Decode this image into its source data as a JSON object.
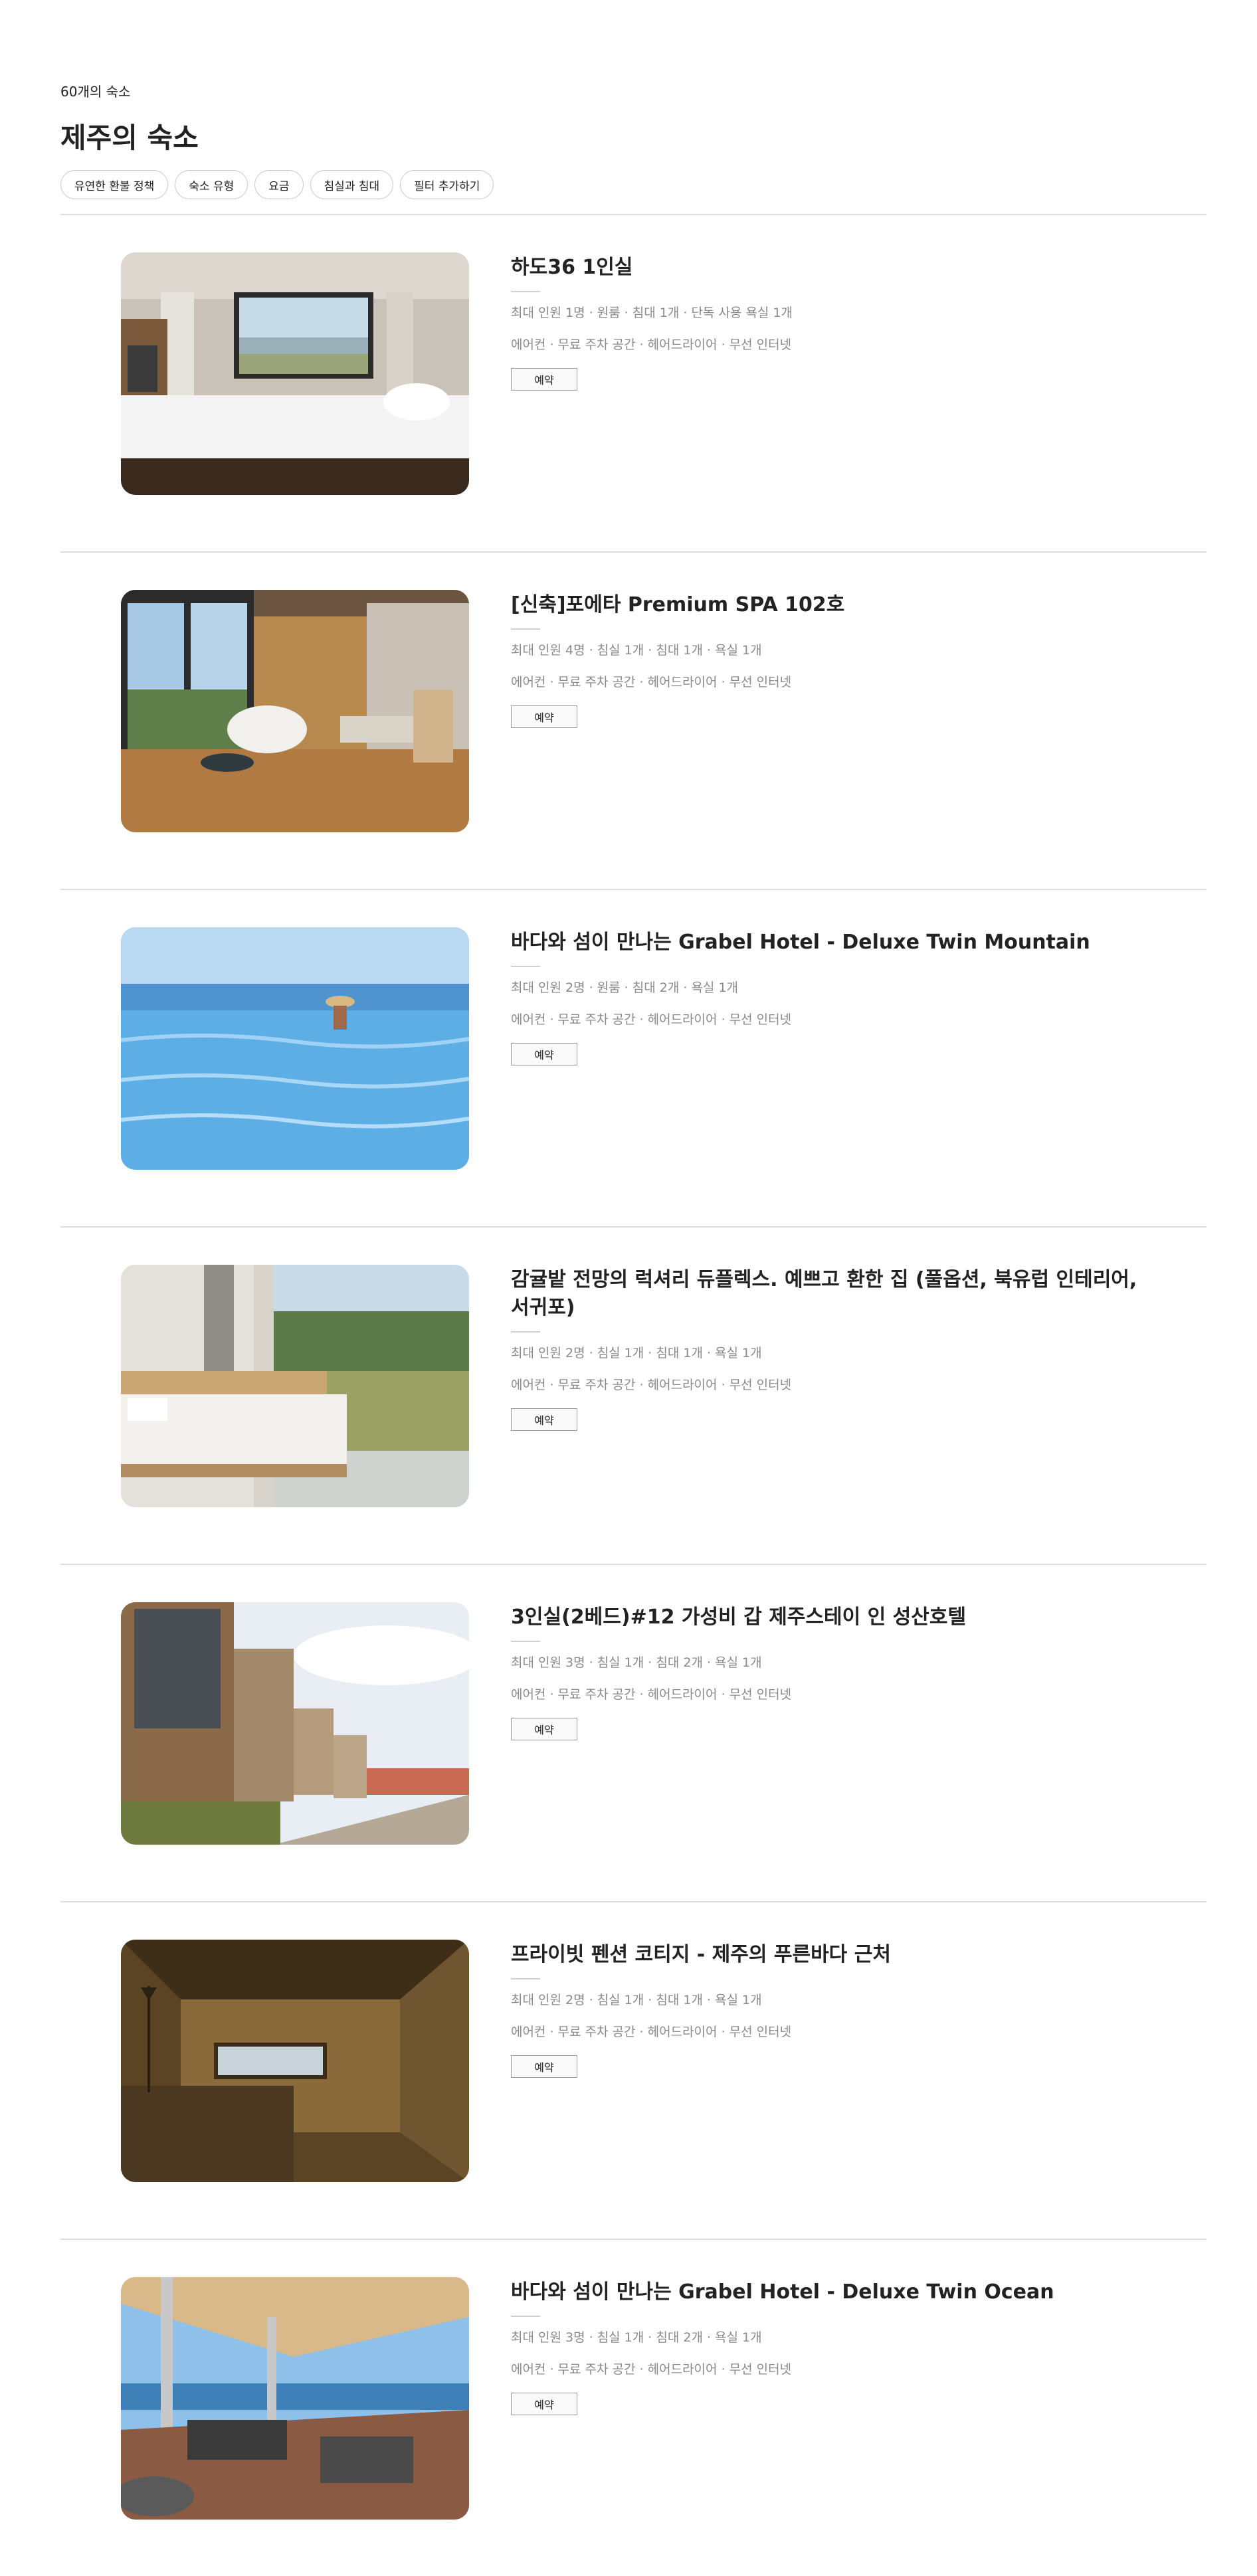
{
  "header": {
    "count": "60개의 숙소",
    "title": "제주의 숙소"
  },
  "filters": [
    "유연한 환불 정책",
    "숙소 유형",
    "요금",
    "침실과 침대",
    "필터 추가하기"
  ],
  "listings": [
    {
      "name": "하도36 1인실",
      "details": "최대 인원 1명 · 원룸 · 침대 1개 · 단독 사용 욕실 1개",
      "amenities": "에어컨 · 무료 주차 공간 · 헤어드라이어 · 무선 인터넷",
      "button": "예약"
    },
    {
      "name": "[신축]포에타 Premium SPA 102호",
      "details": "최대 인원 4명 · 침실 1개 · 침대 1개 · 욕실 1개",
      "amenities": "에어컨 · 무료 주차 공간 · 헤어드라이어 · 무선 인터넷",
      "button": "예약"
    },
    {
      "name": "바다와 섬이 만나는 Grabel Hotel - Deluxe Twin Mountain",
      "details": "최대 인원 2명 · 원룸 · 침대 2개 · 욕실 1개",
      "amenities": "에어컨 · 무료 주차 공간 · 헤어드라이어 · 무선 인터넷",
      "button": "예약"
    },
    {
      "name": "감귤밭 전망의 럭셔리 듀플렉스. 예쁘고 환한 집 (풀옵션, 북유럽 인테리어, 서귀포)",
      "details": "최대 인원 2명 · 침실 1개 · 침대 1개 · 욕실 1개",
      "amenities": "에어컨 · 무료 주차 공간 · 헤어드라이어 · 무선 인터넷",
      "button": "예약"
    },
    {
      "name": "3인실(2베드)#12 가성비 갑 제주스테이 인 성산호텔",
      "details": "최대 인원 3명 · 침실 1개 · 침대 2개 · 욕실 1개",
      "amenities": "에어컨 · 무료 주차 공간 · 헤어드라이어 · 무선 인터넷",
      "button": "예약"
    },
    {
      "name": "프라이빗 펜션 코티지 - 제주의 푸른바다 근처",
      "details": "최대 인원 2명 · 침실 1개 · 침대 1개 · 욕실 1개",
      "amenities": "에어컨 · 무료 주차 공간 · 헤어드라이어 · 무선 인터넷",
      "button": "예약"
    },
    {
      "name": "바다와 섬이 만나는 Grabel Hotel - Deluxe Twin Ocean",
      "details": "최대 인원 3명 · 침실 1개 · 침대 2개 · 욕실 1개",
      "amenities": "에어컨 · 무료 주차 공간 · 헤어드라이어 · 무선 인터넷",
      "button": "예약"
    }
  ]
}
